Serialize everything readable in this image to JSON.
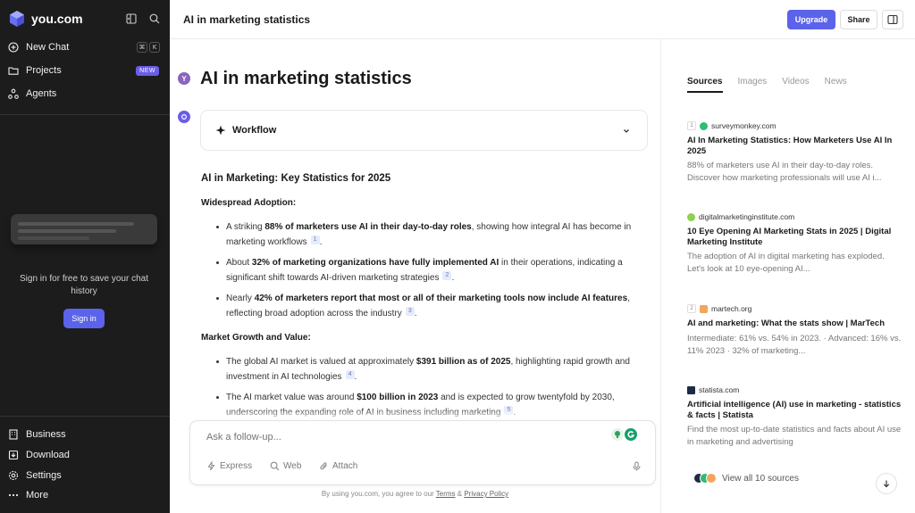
{
  "colors": {
    "sidebar_bg": "#1c1c1c",
    "accent": "#5b63ea",
    "user_avatar": "#8a64bd"
  },
  "sidebar": {
    "logo_text": "you.com",
    "new_chat": {
      "label": "New Chat",
      "shortcut": [
        "⌘",
        "K"
      ]
    },
    "projects": {
      "label": "Projects",
      "badge": "NEW"
    },
    "agents": {
      "label": "Agents"
    },
    "signin_prompt": "Sign in for free to save your chat history",
    "signin_button": "Sign in",
    "bottom_items": [
      {
        "label": "Business",
        "icon": "building-icon"
      },
      {
        "label": "Download",
        "icon": "download-icon"
      },
      {
        "label": "Settings",
        "icon": "gear-icon"
      },
      {
        "label": "More",
        "icon": "dots-icon"
      }
    ]
  },
  "header": {
    "title": "AI in marketing statistics",
    "upgrade": "Upgrade",
    "share": "Share"
  },
  "main": {
    "user_initial": "Y",
    "question": "AI in marketing statistics",
    "workflow_label": "Workflow",
    "answer": {
      "heading": "AI in Marketing: Key Statistics for 2025",
      "sections": [
        {
          "title": "Widespread Adoption:",
          "bullets": [
            {
              "pre": "A striking ",
              "bold": "88% of marketers use AI in their day-to-day roles",
              "post": ", showing how integral AI has become in marketing workflows",
              "cite": "1",
              "end": "."
            },
            {
              "pre": "About ",
              "bold": "32% of marketing organizations have fully implemented AI",
              "post": " in their operations, indicating a significant shift towards AI-driven marketing strategies",
              "cite": "2",
              "end": "."
            },
            {
              "pre": "Nearly ",
              "bold": "42% of marketers report that most or all of their marketing tools now include AI features",
              "post": ", reflecting broad adoption across the industry",
              "cite": "3",
              "end": "."
            }
          ]
        },
        {
          "title": "Market Growth and Value:",
          "bullets": [
            {
              "pre": "The global AI market is valued at approximately ",
              "bold": "$391 billion as of 2025",
              "post": ", highlighting rapid growth and investment in AI technologies",
              "cite": "4",
              "end": "."
            },
            {
              "pre": "The AI market value was around ",
              "bold": "$100 billion in 2023",
              "post": " and is expected to grow twentyfold by 2030, underscoring the expanding role of AI in business including marketing",
              "cite": "5",
              "end": "."
            }
          ]
        }
      ]
    },
    "composer": {
      "placeholder": "Ask a follow-up...",
      "tools": [
        "Express",
        "Web",
        "Attach"
      ]
    },
    "terms": {
      "pre": "By using you.com, you agree to our ",
      "terms": "Terms",
      "amp": " & ",
      "privacy": "Privacy Policy"
    }
  },
  "sources_panel": {
    "tabs": [
      "Sources",
      "Images",
      "Videos",
      "News"
    ],
    "active_tab": "Sources",
    "items": [
      {
        "num": "1",
        "domain": "surveymonkey.com",
        "favicon_color": "#2dbd73",
        "title": "AI In Marketing Statistics: How Marketers Use AI In 2025",
        "desc": "88% of marketers use AI in their day-to-day roles. Discover how marketing professionals will use AI i..."
      },
      {
        "num": "",
        "domain": "digitalmarketinginstitute.com",
        "favicon_color": "#8fd14f",
        "title": "10 Eye Opening AI Marketing Stats in 2025 | Digital Marketing Institute",
        "desc": "The adoption of AI in digital marketing has exploded. Let's look at 10 eye-opening AI..."
      },
      {
        "num": "2",
        "domain": "martech.org",
        "favicon_color": "#f2a65a",
        "title": "AI and marketing: What the stats show | MarTech",
        "desc": "Intermediate: 61% vs. 54% in 2023. · Advanced: 16% vs. 11% 2023 · 32% of marketing..."
      },
      {
        "num": "",
        "domain": "statista.com",
        "favicon_color": "#1f2a44",
        "title": "Artificial intelligence (AI) use in marketing - statistics & facts | Statista",
        "desc": "Find the most up-to-date statistics and facts about AI use in marketing and advertising"
      }
    ],
    "view_all": "View all 10 sources"
  }
}
